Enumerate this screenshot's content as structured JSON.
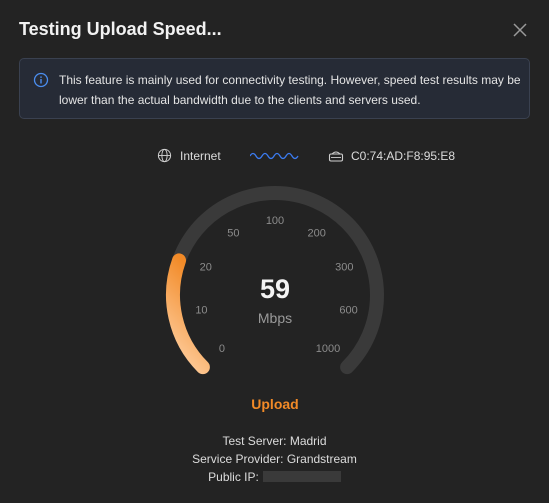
{
  "header": {
    "title": "Testing Upload Speed..."
  },
  "notice": {
    "text": "This feature is mainly used for connectivity testing. However, speed test results may be lower than the actual bandwidth due to the clients and servers used."
  },
  "connection": {
    "internet_label": "Internet",
    "device_mac": "C0:74:AD:F8:95:E8"
  },
  "gauge": {
    "value": "59",
    "unit": "Mbps",
    "mode": "Upload",
    "ticks": [
      "0",
      "10",
      "20",
      "50",
      "100",
      "200",
      "300",
      "600",
      "1000"
    ],
    "progress_fraction": 0.24
  },
  "info": {
    "server": "Test Server: Madrid",
    "provider": "Service Provider: Grandstream",
    "ip_label": "Public IP:"
  },
  "colors": {
    "accent": "#f28a27",
    "gauge_track": "#3a3a3a",
    "info_icon": "#4b8ef0",
    "wave": "#3b7bf0"
  }
}
